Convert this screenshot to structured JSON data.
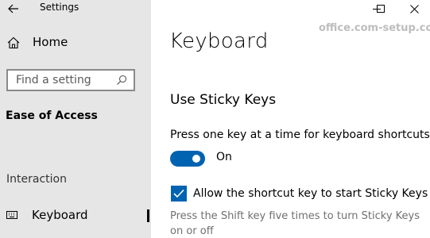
{
  "window": {
    "title": "Settings",
    "controls": {
      "minimize_icon": "minimize-icon",
      "maximize_icon": "maximize-icon",
      "close_icon": "close-icon"
    }
  },
  "sidebar": {
    "back_icon": "back-arrow-icon",
    "home": {
      "label": "Home",
      "icon": "home-icon"
    },
    "search": {
      "placeholder": "Find a setting",
      "icon": "search-icon"
    },
    "category": "Ease of Access",
    "group_label": "Interaction",
    "items": [
      {
        "label": "Keyboard",
        "icon": "keyboard-icon",
        "selected": true
      }
    ]
  },
  "watermark": "office.com-setup.com",
  "main": {
    "page_title": "Keyboard",
    "section_title": "Use Sticky Keys",
    "option1_label": "Press one key at a time for keyboard shortcuts",
    "toggle": {
      "state": "On",
      "on": true
    },
    "checkbox": {
      "label": "Allow the shortcut key to start Sticky Keys",
      "checked": true
    },
    "description_line1": "Press the Shift key five times to turn Sticky Keys",
    "description_line2": "on or off"
  },
  "colors": {
    "accent": "#0063b1",
    "sidebar_bg": "#e6e6e6",
    "muted_text": "#707070",
    "watermark": "#bdbdbd"
  }
}
